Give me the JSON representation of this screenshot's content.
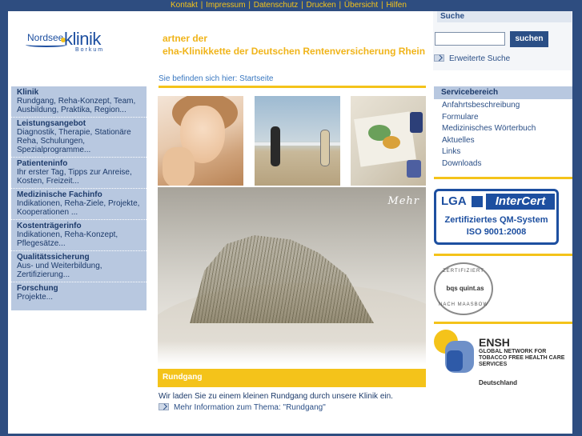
{
  "top_nav": {
    "links": [
      "Kontakt",
      "Impressum",
      "Datenschutz",
      "Drucken",
      "Übersicht",
      "Hilfen"
    ],
    "separator": "|"
  },
  "logo": {
    "brand_left": "Nordsee",
    "brand_right": "klinik",
    "location": "Borkum"
  },
  "banner": {
    "line1": "artner der",
    "line2": "eha-Klinikkette der Deutschen Rentenversicherung Rhein"
  },
  "breadcrumb": "Sie befinden sich hier: Startseite",
  "search": {
    "title": "Suche",
    "input_value": "",
    "button_label": "suchen",
    "advanced_label": "Erweiterte Suche"
  },
  "left_nav": [
    {
      "title": "Klinik",
      "desc": "Rundgang, Reha-Konzept, Team, Ausbildung, Praktika, Region..."
    },
    {
      "title": "Leistungsangebot",
      "desc": "Diagnostik, Therapie, Stationäre Reha, Schulungen, Spezialprogramme..."
    },
    {
      "title": "Patienteninfo",
      "desc": "Ihr erster Tag, Tipps zur Anreise, Kosten, Freizeit..."
    },
    {
      "title": "Medizinische Fachinfo",
      "desc": "Indikationen, Reha-Ziele, Projekte, Kooperationen ..."
    },
    {
      "title": "Kostenträgerinfo",
      "desc": "Indikationen, Reha-Konzept, Pflegesätze..."
    },
    {
      "title": "Qualitätssicherung",
      "desc": "Aus- und Weiterbildung, Zertifizierung..."
    },
    {
      "title": "Forschung",
      "desc": "Projekte..."
    }
  ],
  "hero": {
    "more_label": "Mehr"
  },
  "rundgang": {
    "heading": "Rundgang",
    "text": "Wir laden Sie zu einem kleinen Rundgang durch unsere Klinik ein.",
    "link": "Mehr Information zum Thema: \"Rundgang\""
  },
  "service": {
    "title": "Servicebereich",
    "items": [
      "Anfahrtsbeschreibung",
      "Formulare",
      "Medizinisches Wörterbuch",
      "Aktuelles",
      "Links",
      "Downloads"
    ]
  },
  "certs": {
    "intercert": {
      "lga": "LGA",
      "brand": "InterCert",
      "line1": "Zertifiziertes QM-System",
      "line2": "ISO 9001:2008"
    },
    "quintas": {
      "top": "ZERTIFIZIERT",
      "name": "bqs quint.as",
      "bottom": "NACH MAASBOW"
    },
    "ensh": {
      "title": "ENSH",
      "subtitle": "GLOBAL NETWORK FOR TOBACCO FREE HEALTH CARE SERVICES",
      "country": "Deutschland"
    }
  },
  "colors": {
    "background": "#2e4d80",
    "accent_yellow": "#f4c31a",
    "nav_blue": "#b8c8e0",
    "brand_blue": "#1d4fa0"
  }
}
